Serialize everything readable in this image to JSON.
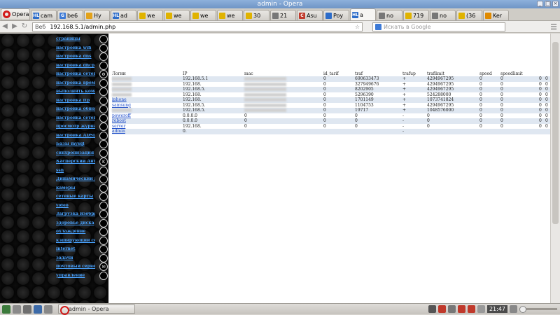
{
  "window": {
    "title": "admin - Opera"
  },
  "browser": {
    "opera_label": "Opera",
    "tabs": [
      {
        "label": "cam",
        "fav": "HL",
        "color": "#2c6cc9"
      },
      {
        "label": "be6",
        "fav": "G",
        "color": "#3d7ad6"
      },
      {
        "label": "Ну",
        "fav": "",
        "color": "#e3a21a"
      },
      {
        "label": "ad",
        "fav": "HL",
        "color": "#2c6cc9"
      },
      {
        "label": "we",
        "fav": "",
        "color": "#e0b300"
      },
      {
        "label": "we",
        "fav": "",
        "color": "#e0b300"
      },
      {
        "label": "we",
        "fav": "",
        "color": "#e0b300"
      },
      {
        "label": "we",
        "fav": "",
        "color": "#e0b300"
      },
      {
        "label": "30",
        "fav": "",
        "color": "#e0b300"
      },
      {
        "label": "21",
        "fav": "",
        "color": "#777777"
      },
      {
        "label": "Asu",
        "fav": "C",
        "color": "#c0392b"
      },
      {
        "label": "Poy",
        "fav": "",
        "color": "#2c6cc9"
      },
      {
        "label": "a",
        "fav": "HL",
        "color": "#2c6cc9"
      },
      {
        "label": "no",
        "fav": "",
        "color": "#777777"
      },
      {
        "label": "719",
        "fav": "",
        "color": "#e0b300"
      },
      {
        "label": "no",
        "fav": "",
        "color": "#777777"
      },
      {
        "label": "(36",
        "fav": "",
        "color": "#e0b300"
      },
      {
        "label": "Ker",
        "fav": "",
        "color": "#e08a00"
      }
    ],
    "active_tab_index": 12,
    "address": {
      "identity": "Веб",
      "url": "192.168.5.1/admin.php"
    },
    "search_placeholder": "Искать в Google"
  },
  "sidebar": {
    "items": [
      {
        "label": "страницы",
        "icon": ""
      },
      {
        "label": "настройка wifi",
        "icon": ""
      },
      {
        "label": "настройка dns",
        "icon": ""
      },
      {
        "label": "настройка dhcp",
        "icon": ""
      },
      {
        "label": "настройка сетевых",
        "icon": "⚙"
      },
      {
        "label": "настройка времени",
        "icon": ""
      },
      {
        "label": "выполнить команду",
        "icon": ""
      },
      {
        "label": "настройка ftp",
        "icon": ""
      },
      {
        "label": "настройка обновления",
        "icon": ""
      },
      {
        "label": "настройка сетевых папок",
        "icon": ""
      },
      {
        "label": "просмотр журнала",
        "icon": ""
      },
      {
        "label": "настройка ADSL",
        "icon": ""
      },
      {
        "label": "Базы mysql",
        "icon": ""
      },
      {
        "label": "синхронизация",
        "icon": ""
      },
      {
        "label": "Касперский Антивирус",
        "icon": "K"
      },
      {
        "label": "ssh",
        "icon": ""
      },
      {
        "label": "Динамический DNS",
        "icon": ""
      },
      {
        "label": "камеры",
        "icon": ""
      },
      {
        "label": "сетевые карты",
        "icon": ""
      },
      {
        "label": "video",
        "icon": ""
      },
      {
        "label": "Загрузка изображений",
        "icon": ""
      },
      {
        "label": "здоровье диска",
        "icon": ""
      },
      {
        "label": "охлаждение",
        "icon": ""
      },
      {
        "label": "кэширующий сервер",
        "icon": ""
      },
      {
        "label": "internet",
        "icon": ""
      },
      {
        "label": "задачи",
        "icon": ""
      },
      {
        "label": "почтовый сервер",
        "icon": "✉"
      },
      {
        "label": "управление",
        "icon": ""
      }
    ]
  },
  "table": {
    "headers": [
      "Логин",
      "IP",
      "mac",
      "id_tarif",
      "traf",
      "trafup",
      "traflimit",
      "speed",
      "speedlimit",
      "",
      ""
    ],
    "rows": [
      [
        "",
        "192.168.5.1",
        "",
        "0",
        "690633473",
        "+",
        "4294967295",
        "0",
        "0",
        "0",
        "0"
      ],
      [
        "",
        "192.168.",
        "",
        "0",
        "327949676",
        "+",
        "4294967295",
        "0",
        "0",
        "0",
        "0"
      ],
      [
        "",
        "192.168.5.",
        "",
        "0",
        "8202905",
        "+",
        "4294967295",
        "0",
        "0",
        "0",
        "0"
      ],
      [
        "",
        "192.168.",
        "",
        "0",
        "5296390",
        "+",
        "524288000",
        "0",
        "0",
        "0",
        "0"
      ],
      [
        "iphone",
        "192.168.",
        "",
        "0",
        "1701149",
        "+",
        "1073741824",
        "0",
        "0",
        "0",
        "0"
      ],
      [
        "samsung",
        "192.168.5.",
        "",
        "0",
        "1104753",
        "+",
        "4294967295",
        "0",
        "0",
        "0",
        "0"
      ],
      [
        "",
        "192.168.5.",
        "",
        "0",
        "19717",
        "+",
        "1048576000",
        "0",
        "0",
        "0",
        "0"
      ],
      [
        "poweroff",
        "0.0.0.0",
        "0",
        "0",
        "0",
        "-",
        "0",
        "0",
        "0",
        "0",
        "0"
      ],
      [
        "reboot",
        "0.0.0.0",
        "0",
        "0",
        "0",
        "-",
        "0",
        "0",
        "0",
        "0",
        "0"
      ],
      [
        "server",
        "192.168.",
        "0",
        "0",
        "0",
        "-",
        "0",
        "0",
        "0",
        "0",
        "0"
      ],
      [
        "admin",
        "0.",
        "",
        "",
        "",
        "-",
        "",
        "",
        "",
        "",
        ""
      ]
    ]
  },
  "taskbar": {
    "task_label": "admin - Opera",
    "clock": "21:47"
  }
}
